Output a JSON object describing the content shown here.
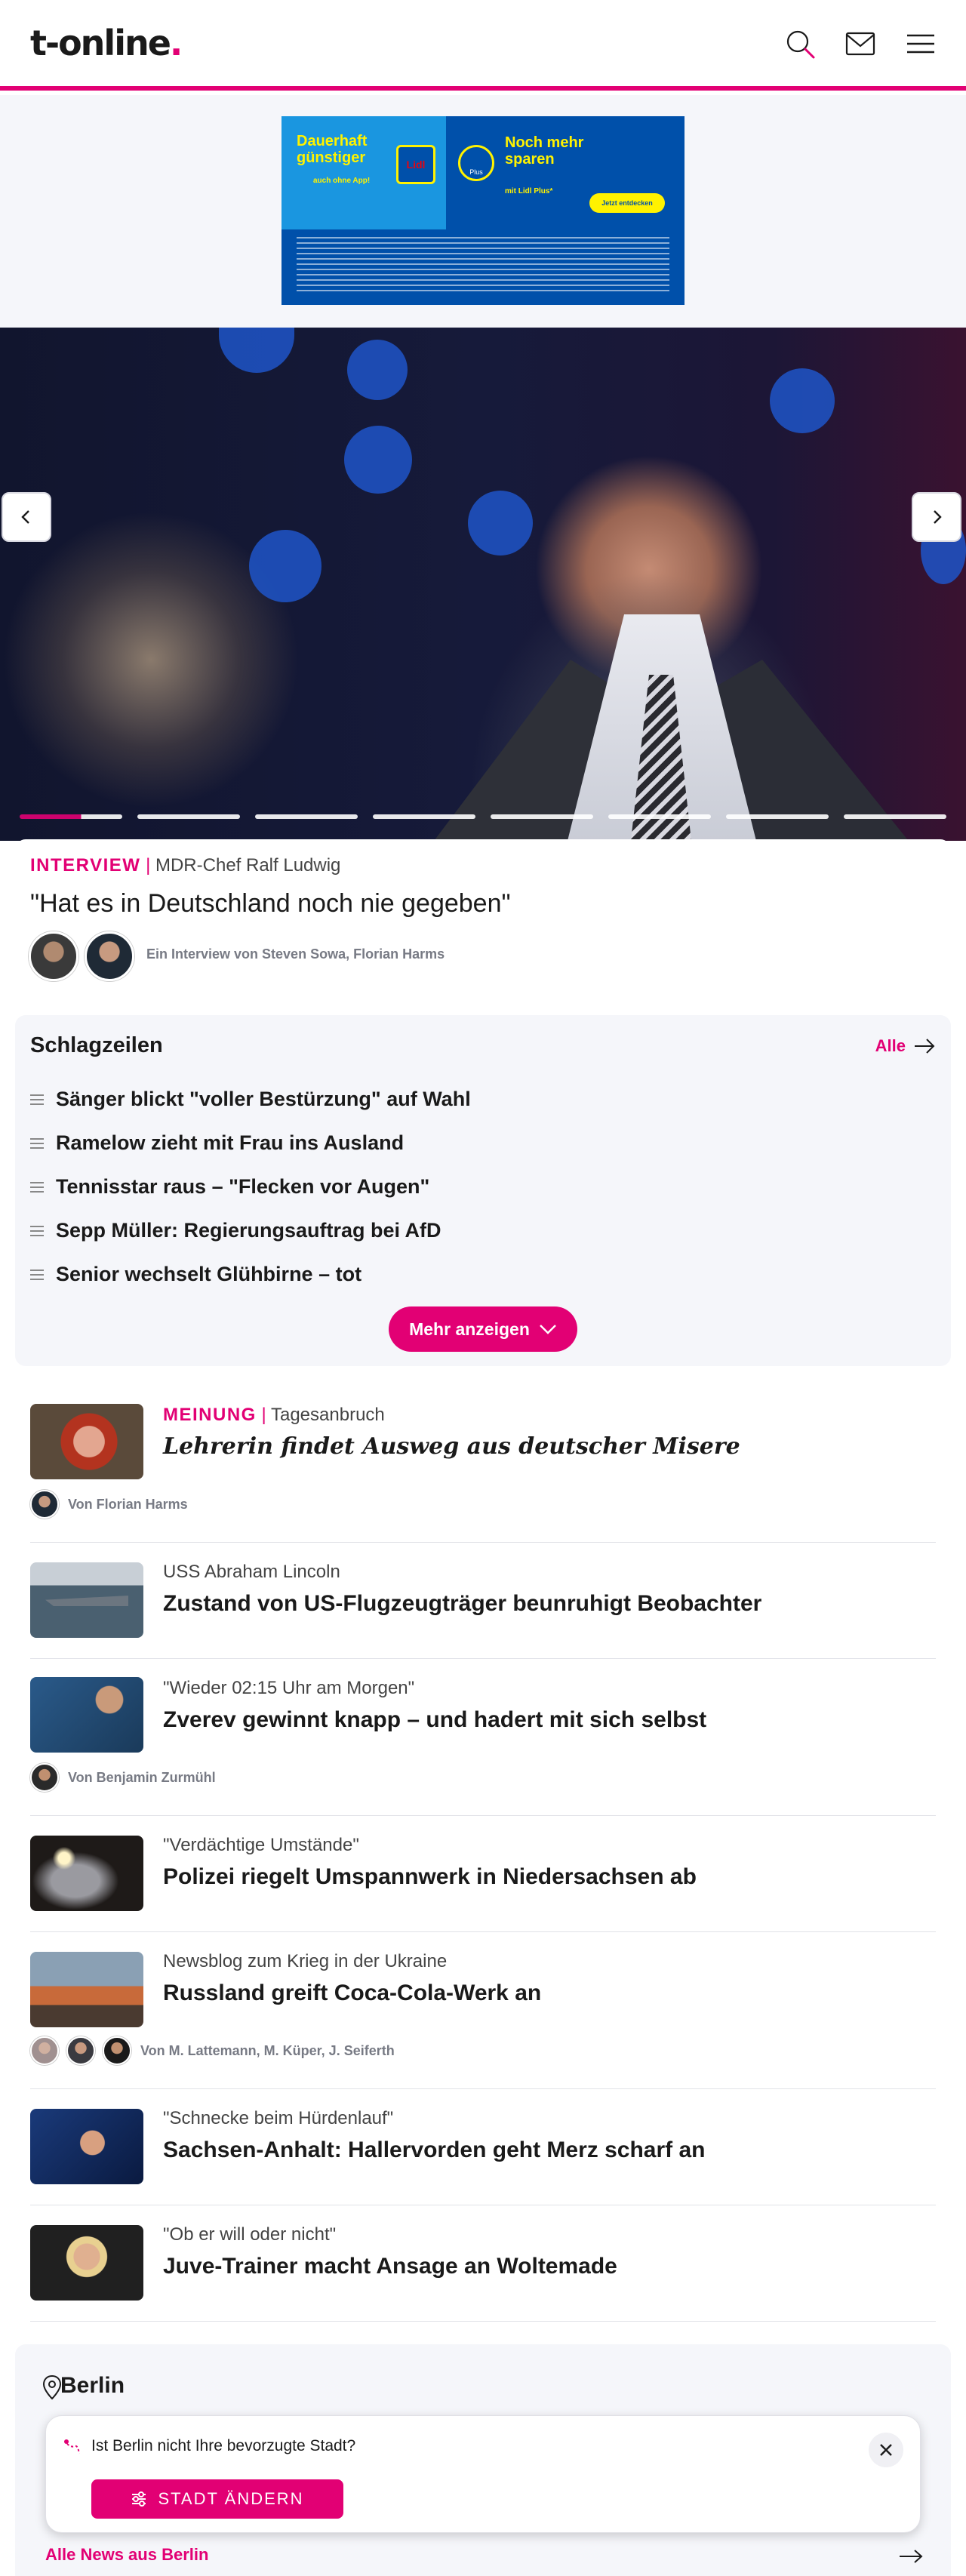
{
  "header": {
    "logo_text": "t-online",
    "logo_dot": ".",
    "icons": [
      "search-icon",
      "mail-icon",
      "menu-icon"
    ],
    "accent_color": "#e20074"
  },
  "ad": {
    "left_headline_1": "Dauerhaft",
    "left_headline_2": "günstiger",
    "left_sub": "auch ohne App!",
    "lidl_logo": "Lidl",
    "lidl_plus_logo": "Plus",
    "right_headline_1": "Noch mehr",
    "right_headline_2": "sparen",
    "right_sub": "mit Lidl Plus*",
    "cta": "Jetzt entdecken"
  },
  "hero": {
    "kicker_label": "INTERVIEW",
    "kicker_separator": "|",
    "kicker_text": "MDR-Chef Ralf Ludwig",
    "title": "\"Hat es in Deutschland noch nie gegeben\"",
    "byline": "Ein Interview von Steven Sowa, Florian Harms",
    "slide_count": 8,
    "active_slide": 1
  },
  "headlines": {
    "title": "Schlagzeilen",
    "all_label": "Alle",
    "items": [
      "Sänger blickt \"voller Bestürzung\" auf Wahl",
      "Ramelow zieht mit Frau ins Ausland",
      "Tennisstar raus – \"Flecken vor Augen\"",
      "Sepp Müller: Regierungsauftrag bei AfD",
      "Senior wechselt Glühbirne – tot"
    ],
    "more_label": "Mehr anzeigen"
  },
  "articles": [
    {
      "kicker_label": "MEINUNG",
      "kicker_text": "Tagesanbruch",
      "title": "Lehrerin findet Ausweg aus deutscher Misere",
      "byline": "Von Florian Harms"
    },
    {
      "kicker_text": "USS Abraham Lincoln",
      "title": "Zustand von US-Flugzeugträger beunruhigt Beobachter"
    },
    {
      "kicker_text": "\"Wieder 02:15 Uhr am Morgen\"",
      "title": "Zverev gewinnt knapp – und hadert mit sich selbst",
      "byline": "Von Benjamin Zurmühl"
    },
    {
      "kicker_text": "\"Verdächtige Umstände\"",
      "title": "Polizei riegelt Umspannwerk in Niedersachsen ab"
    },
    {
      "kicker_text": "Newsblog zum Krieg in der Ukraine",
      "title": "Russland greift Coca-Cola-Werk an",
      "byline": "Von M. Lattemann, M. Küper, J. Seiferth"
    },
    {
      "kicker_text": "\"Schnecke beim Hürdenlauf\"",
      "title": "Sachsen-Anhalt: Hallervorden geht Merz scharf an"
    },
    {
      "kicker_text": "\"Ob er will oder nicht\"",
      "title": "Juve-Trainer macht Ansage an Woltemade"
    }
  ],
  "berlin": {
    "title": "Berlin",
    "question": "Ist Berlin nicht Ihre bevorzugte Stadt?",
    "change_button": "STADT ÄNDERN",
    "all_news": "Alle News aus Berlin"
  }
}
